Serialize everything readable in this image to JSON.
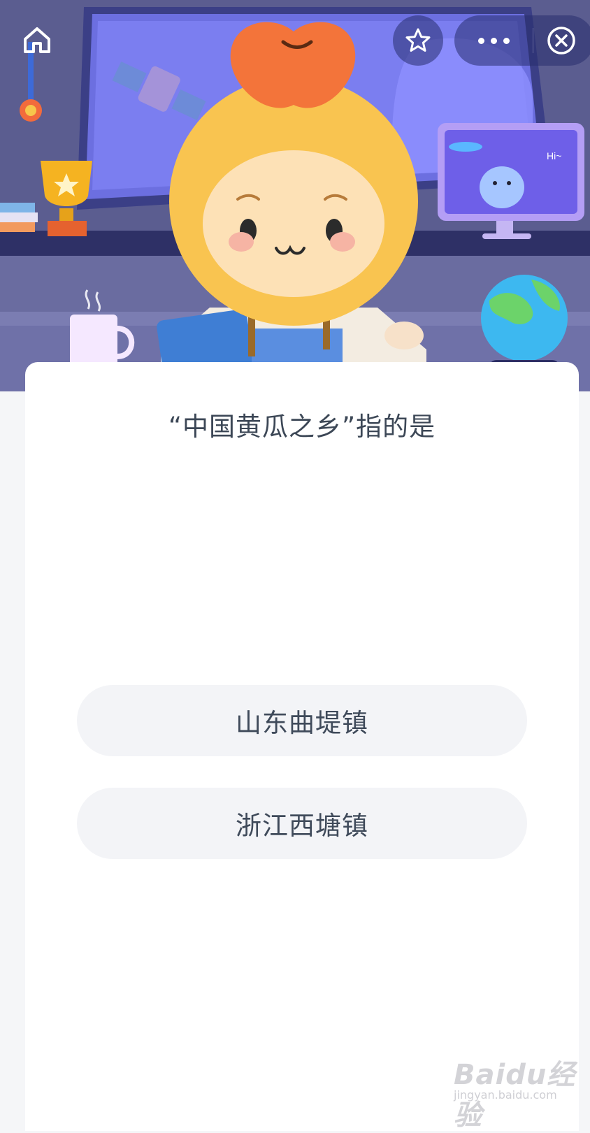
{
  "header": {
    "home_icon": "home-icon",
    "star_icon": "star-icon",
    "more_icon": "more-icon",
    "close_icon": "close-icon"
  },
  "illustration": {
    "bubble_text": "Hi~"
  },
  "quiz": {
    "question": "“中国黄瓜之乡”指的是",
    "options": [
      {
        "label": "山东曲堤镇"
      },
      {
        "label": "浙江西塘镇"
      }
    ]
  },
  "watermark": {
    "logo": "Baidu经验",
    "url": "jingyan.baidu.com"
  },
  "colors": {
    "scene_bg": "#5d5f93",
    "card_bg": "#ffffff",
    "option_bg": "#f3f4f7",
    "text": "#3c4756"
  }
}
